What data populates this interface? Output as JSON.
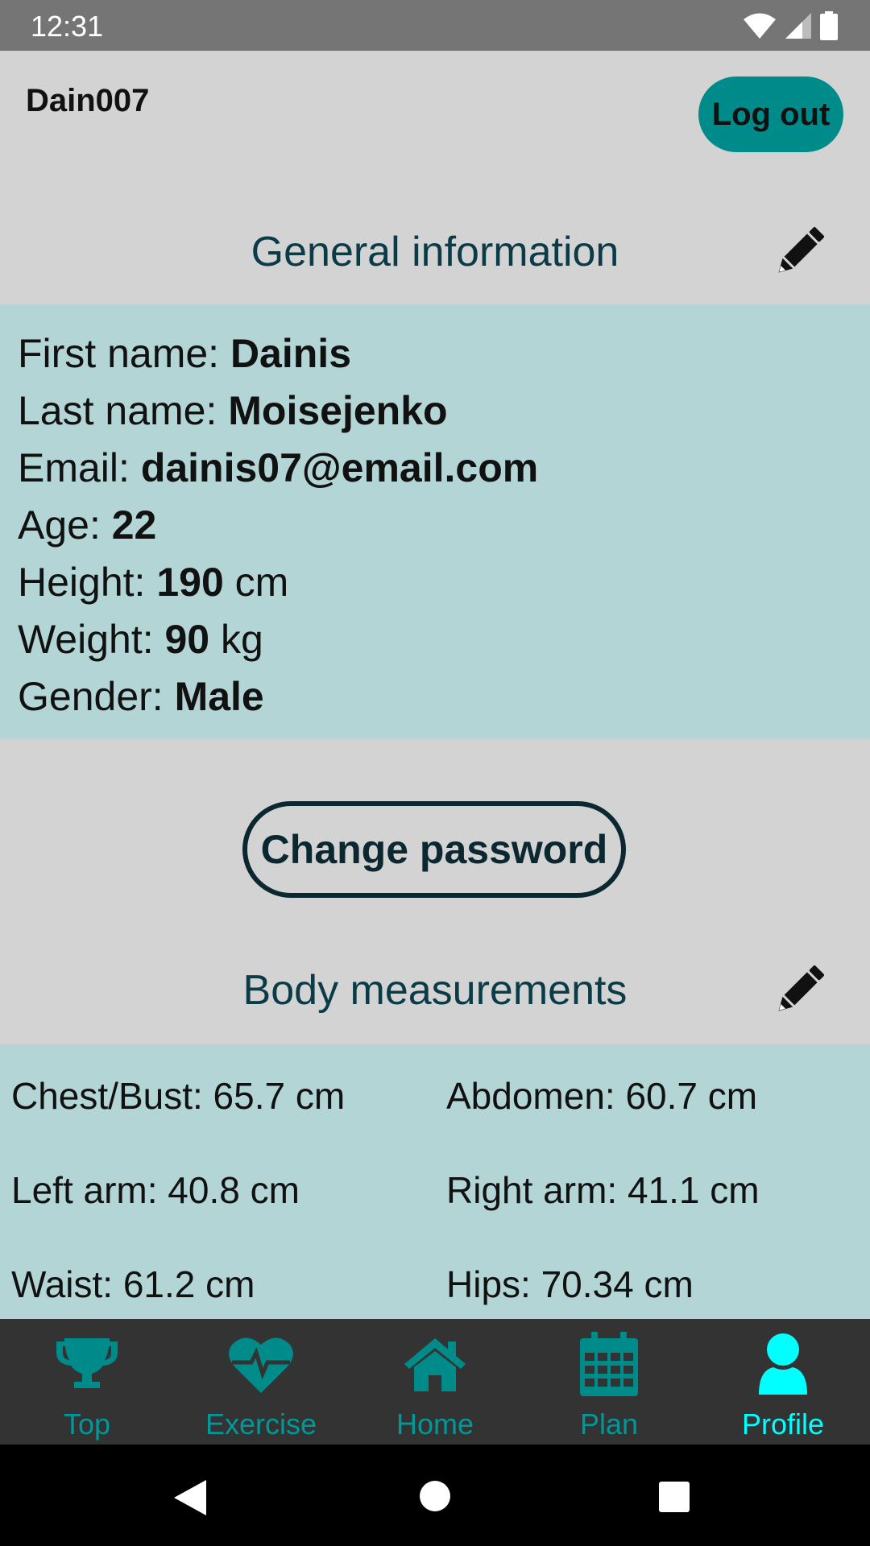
{
  "status_bar": {
    "time": "12:31"
  },
  "header": {
    "username": "Dain007",
    "logout_label": "Log out"
  },
  "general": {
    "title": "General information",
    "rows": [
      {
        "label": "First name: ",
        "value": "Dainis",
        "unit": ""
      },
      {
        "label": "Last name: ",
        "value": "Moisejenko",
        "unit": ""
      },
      {
        "label": "Email: ",
        "value": "dainis07@email.com",
        "unit": ""
      },
      {
        "label": "Age: ",
        "value": "22",
        "unit": ""
      },
      {
        "label": "Height: ",
        "value": "190",
        "unit": " cm"
      },
      {
        "label": "Weight: ",
        "value": "90",
        "unit": " kg"
      },
      {
        "label": "Gender: ",
        "value": "Male",
        "unit": ""
      }
    ]
  },
  "change_password_label": "Change password",
  "body": {
    "title": "Body measurements",
    "items": [
      "Chest/Bust: 65.7 cm",
      "Abdomen: 60.7 cm",
      "Left arm: 40.8 cm",
      "Right arm: 41.1 cm",
      "Waist: 61.2 cm",
      "Hips: 70.34 cm"
    ]
  },
  "nav": {
    "items": [
      {
        "label": "Top",
        "icon": "trophy-icon"
      },
      {
        "label": "Exercise",
        "icon": "heartbeat-icon"
      },
      {
        "label": "Home",
        "icon": "home-icon"
      },
      {
        "label": "Plan",
        "icon": "calendar-icon"
      },
      {
        "label": "Profile",
        "icon": "user-icon",
        "active": true
      }
    ]
  },
  "colors": {
    "accent": "#008b8b",
    "panel": "#b3d5d5",
    "background": "#d3d3d3",
    "nav_active": "#00ffff",
    "nav_inactive": "#009898"
  }
}
